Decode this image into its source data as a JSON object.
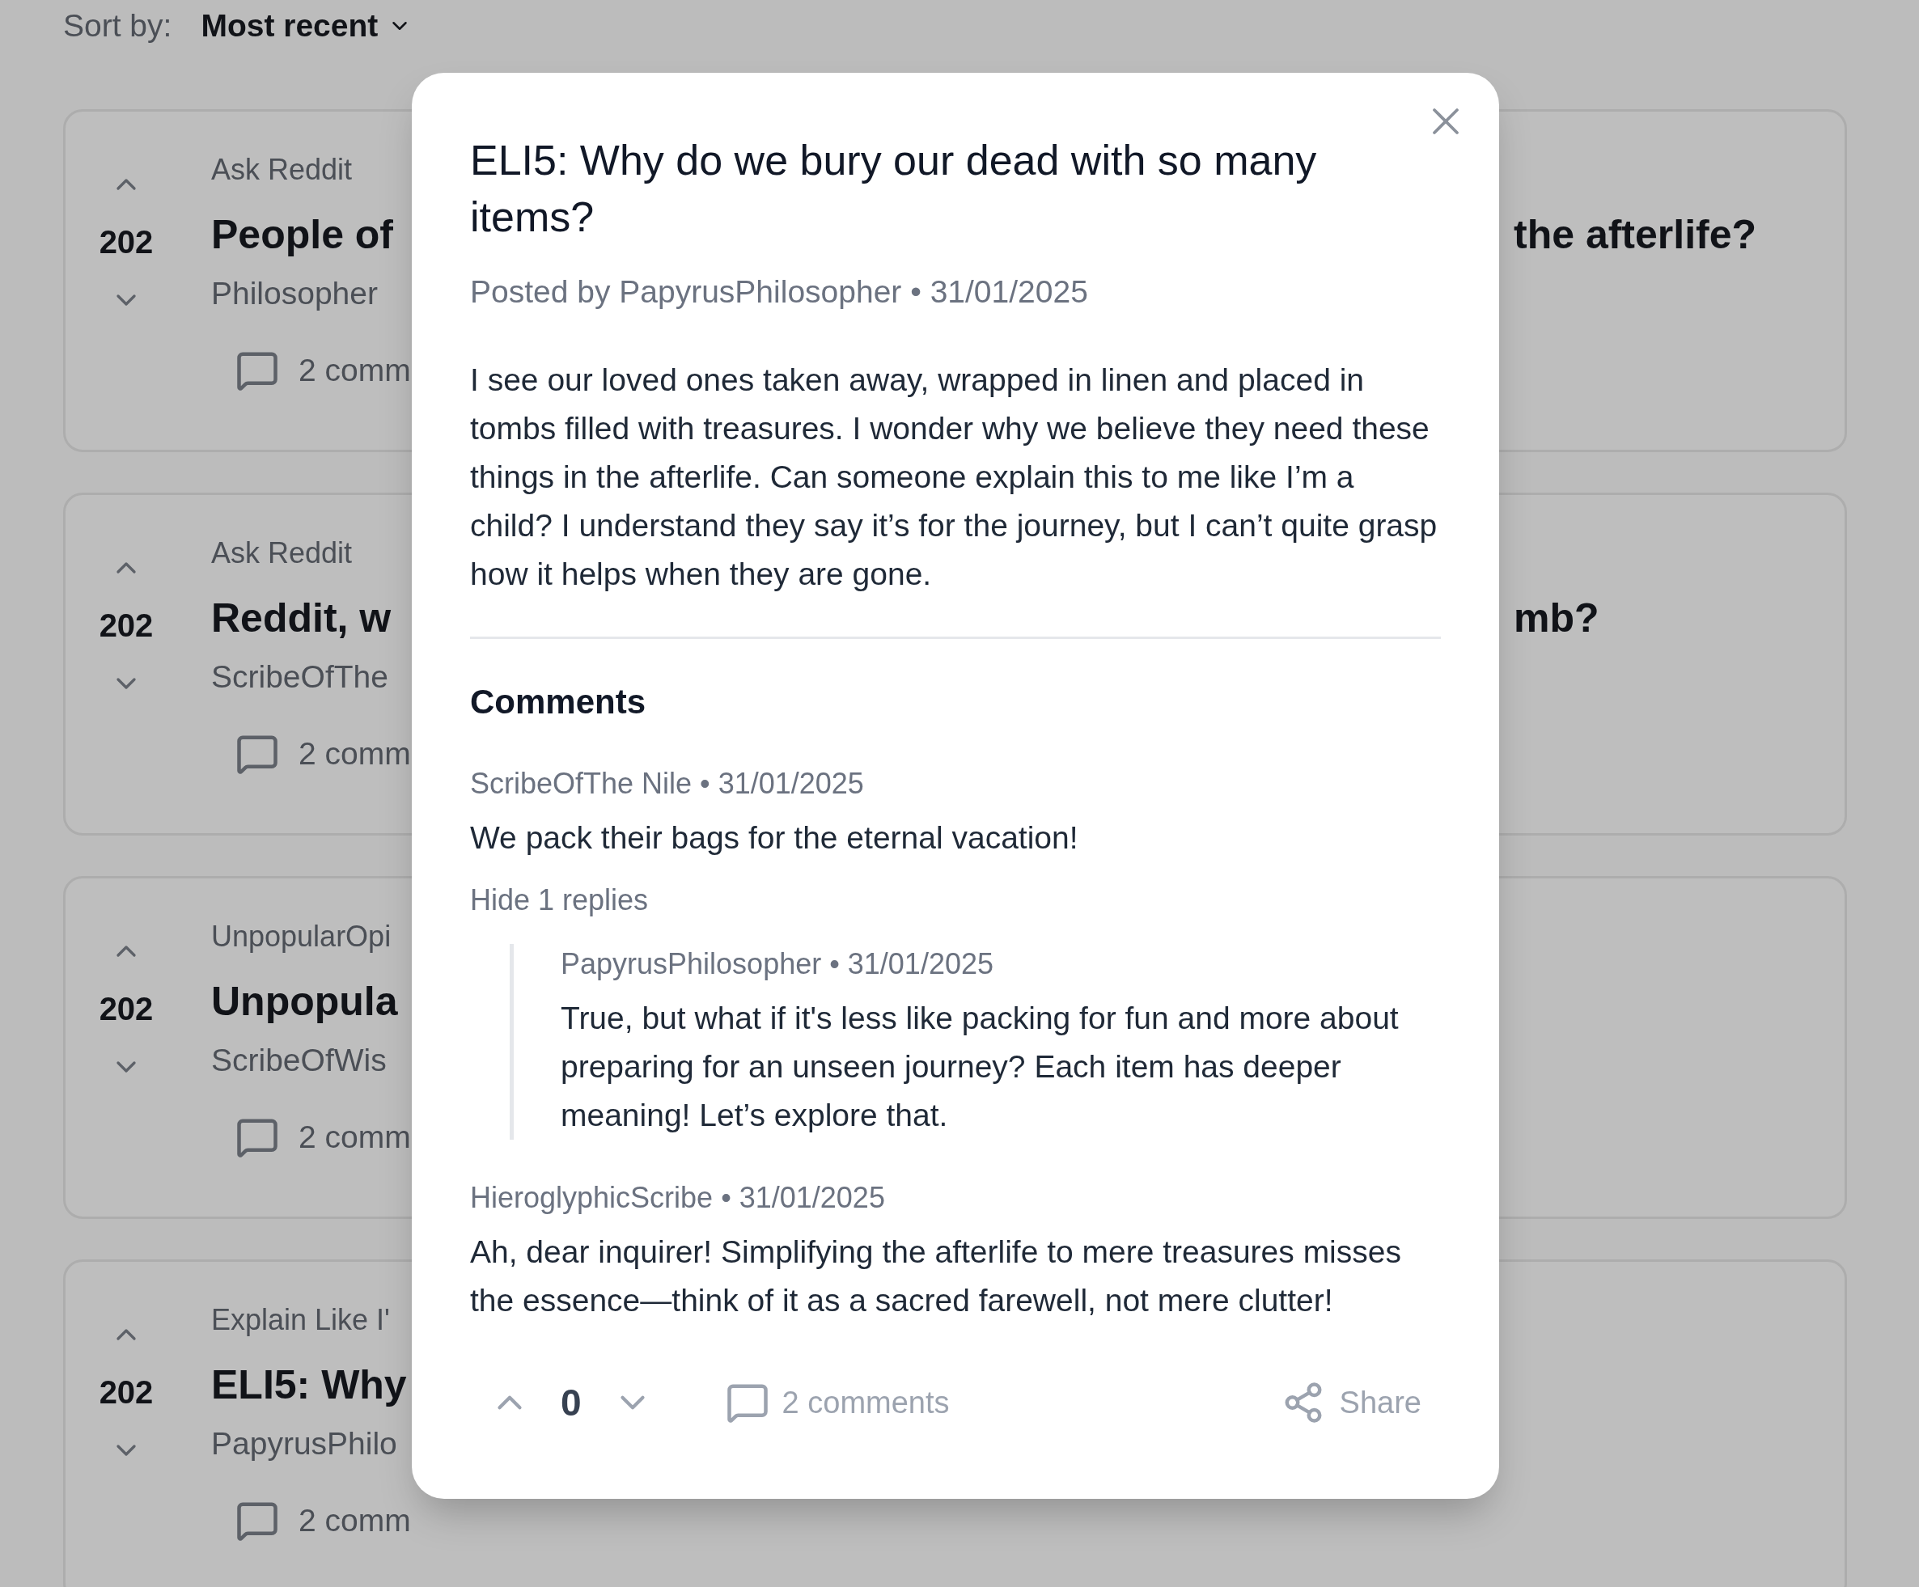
{
  "sort": {
    "label": "Sort by:",
    "value": "Most recent"
  },
  "posts": [
    {
      "subreddit": "Ask Reddit",
      "votes": "202",
      "title_left": "People of",
      "title_right": "the afterlife?",
      "author": "Philosopher",
      "comments": "2 comm"
    },
    {
      "subreddit": "Ask Reddit",
      "votes": "202",
      "title_left": "Reddit, w",
      "title_right": "mb?",
      "author": "ScribeOfThe",
      "comments": "2 comm"
    },
    {
      "subreddit": "UnpopularOpi",
      "votes": "202",
      "title_left": "Unpopula",
      "author": "ScribeOfWis",
      "comments": "2 comm"
    },
    {
      "subreddit": "Explain Like I'",
      "votes": "202",
      "title_left": "ELI5: Why",
      "author": "PapyrusPhilo",
      "comments": "2 comm"
    }
  ],
  "modal": {
    "title": "ELI5: Why do we bury our dead with so many items?",
    "posted_prefix": "Posted by",
    "author": "PapyrusPhilosopher",
    "date": "• 31/01/2025",
    "body": "I see our loved ones taken away, wrapped in linen and placed in tombs filled with treasures. I wonder why we believe they need these things in the afterlife. Can someone explain this to me like I’m a child? I understand they say it’s for the journey, but I can’t quite grasp how it helps when they are gone.",
    "comments_heading": "Comments",
    "comments": [
      {
        "author": "ScribeOfThe Nile",
        "date": "• 31/01/2025",
        "text": "We pack their bags for the eternal vacation!",
        "toggle": "Hide 1 replies",
        "expanded": true,
        "replies": [
          {
            "author": "PapyrusPhilosopher",
            "date": "• 31/01/2025",
            "text": "True, but what if it's less like packing for fun and more about preparing for an unseen journey? Each item has deeper meaning! Let’s explore that."
          }
        ]
      },
      {
        "author": "HieroglyphicScribe",
        "date": "• 31/01/2025",
        "text": "Ah, dear inquirer! Simplifying the afterlife to mere treasures misses the essence—think of it as a sacred farewell, not mere clutter!"
      }
    ],
    "footer": {
      "votes": "0",
      "comments": "2 comments",
      "share": "Share"
    }
  }
}
